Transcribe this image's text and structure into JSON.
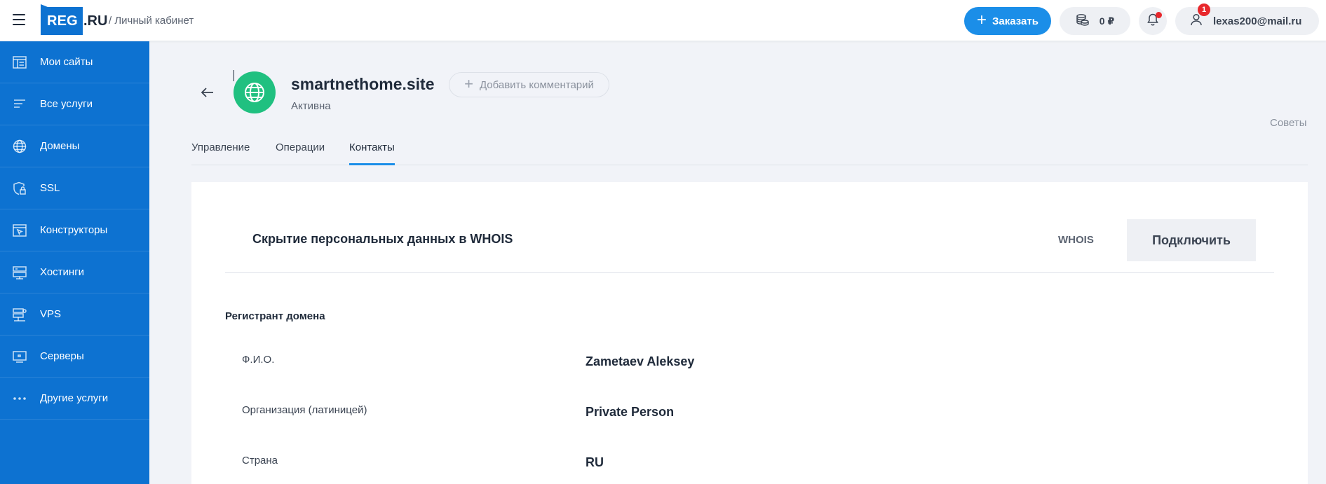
{
  "header": {
    "logo_main": "REG",
    "logo_suffix": ".RU",
    "breadcrumb": "/ Личный кабинет",
    "order_label": "Заказать",
    "balance": "0 ₽",
    "user_email": "lexas200@mail.ru",
    "notification_count": "1"
  },
  "sidebar": {
    "items": [
      {
        "label": "Мои сайты",
        "icon": "layout-icon"
      },
      {
        "label": "Все услуги",
        "icon": "list-icon"
      },
      {
        "label": "Домены",
        "icon": "globe-icon"
      },
      {
        "label": "SSL",
        "icon": "shield-lock-icon"
      },
      {
        "label": "Конструкторы",
        "icon": "constructor-icon"
      },
      {
        "label": "Хостинги",
        "icon": "hosting-icon"
      },
      {
        "label": "VPS",
        "icon": "vps-icon"
      },
      {
        "label": "Серверы",
        "icon": "server-icon"
      },
      {
        "label": "Другие услуги",
        "icon": "more-icon"
      }
    ]
  },
  "page": {
    "domain": "smartnethome.site",
    "status": "Активна",
    "add_comment": "Добавить комментарий",
    "tips": "Советы"
  },
  "tabs": [
    {
      "label": "Управление",
      "active": false
    },
    {
      "label": "Операции",
      "active": false
    },
    {
      "label": "Контакты",
      "active": true
    }
  ],
  "whois": {
    "title": "Скрытие персональных данных в WHOIS",
    "link": "WHOIS",
    "button": "Подключить"
  },
  "registrant": {
    "section_title": "Регистрант домена",
    "fields": [
      {
        "label": "Ф.И.О.",
        "value": "Zametaev Aleksey"
      },
      {
        "label": "Организация (латиницей)",
        "value": "Private Person"
      },
      {
        "label": "Страна",
        "value": "RU"
      }
    ]
  },
  "colors": {
    "accent": "#0d72d1",
    "button_blue": "#1b8ee8",
    "active_green": "#20c080",
    "badge_red": "#e8282c"
  }
}
